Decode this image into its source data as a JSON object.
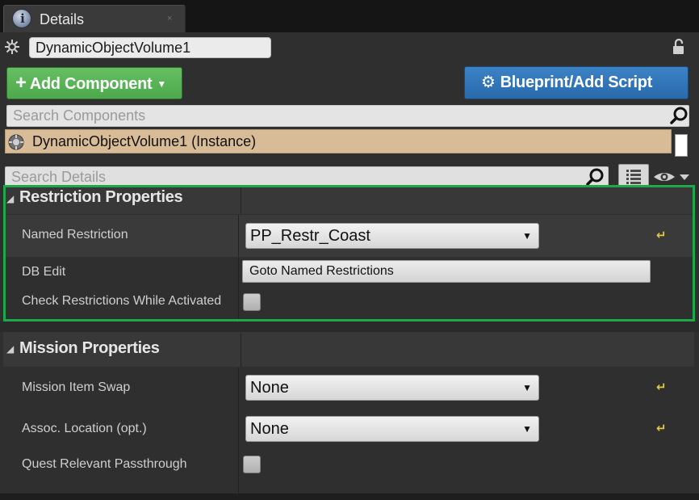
{
  "tab": {
    "title": "Details",
    "close_glyph": "×",
    "icon": "info-icon"
  },
  "actor": {
    "name": "DynamicObjectVolume1"
  },
  "toolbar": {
    "add_component_label": "Add Component",
    "blueprint_label": "Blueprint/Add Script",
    "add_color": "#55b052",
    "blueprint_color": "#2f74b8"
  },
  "components": {
    "search_placeholder": "Search Components",
    "instance_label": "DynamicObjectVolume1 (Instance)",
    "instance_color": "#d8bb97"
  },
  "details": {
    "search_placeholder": "Search Details"
  },
  "sections": [
    {
      "title": "Restriction Properties",
      "highlight_color": "#1ea84a",
      "rows": [
        {
          "label": "Named Restriction",
          "type": "dropdown",
          "value": "PP_Restr_Coast",
          "has_reset": true
        },
        {
          "label": "DB Edit",
          "type": "button",
          "value": "Goto Named Restrictions"
        },
        {
          "label": "Check Restrictions While Activated",
          "type": "checkbox",
          "checked": false
        }
      ]
    },
    {
      "title": "Mission Properties",
      "rows": [
        {
          "label": "Mission Item Swap",
          "type": "dropdown",
          "value": "None",
          "has_reset": true
        },
        {
          "label": "Assoc. Location (opt.)",
          "type": "dropdown",
          "value": "None",
          "has_reset": true
        },
        {
          "label": "Quest Relevant Passthrough",
          "type": "checkbox",
          "checked": false
        }
      ]
    }
  ]
}
